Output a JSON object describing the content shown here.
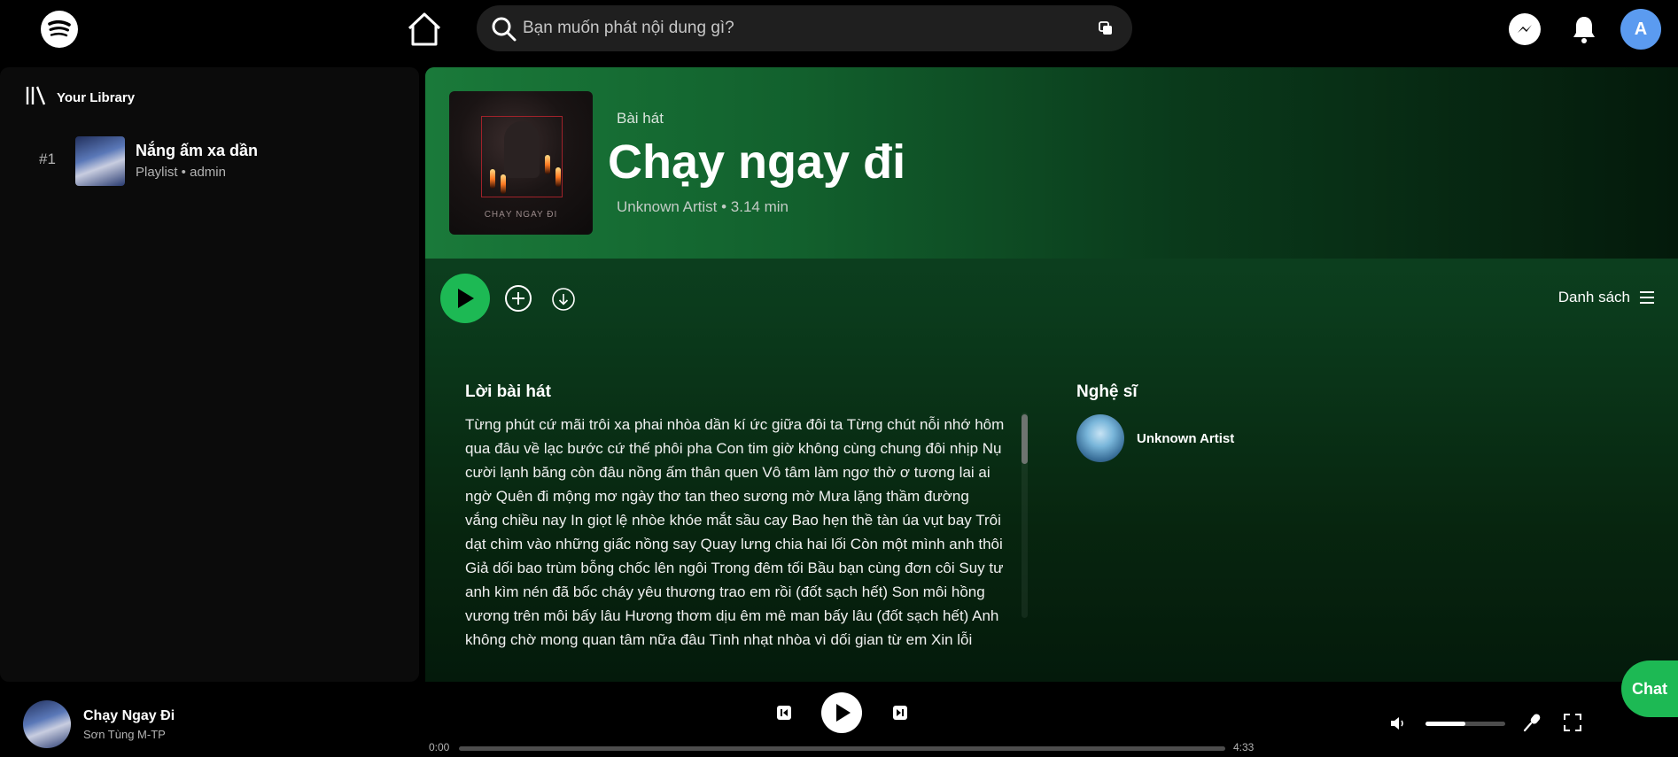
{
  "topbar": {
    "search_placeholder": "Bạn muốn phát nội dung gì?",
    "avatar_initial": "A"
  },
  "library": {
    "title": "Your Library",
    "items": [
      {
        "index": "#1",
        "title": "Nắng ấm xa dần",
        "subtitle": "Playlist • admin"
      }
    ]
  },
  "song": {
    "type_label": "Bài hát",
    "title": "Chạy ngay đi",
    "meta": "Unknown Artist • 3.14 min",
    "cover_text": "CHẠY NGAY ĐI"
  },
  "actions": {
    "list_view_label": "Danh sách"
  },
  "lyrics": {
    "heading": "Lời bài hát",
    "text": "Từng phút cứ mãi trôi xa phai nhòa dần kí ức giữa đôi ta Từng chút nỗi nhớ hôm qua đâu về lạc bước cứ thế phôi pha Con tim giờ không cùng chung đôi nhịp Nụ cười lạnh băng còn đâu nồng ấm thân quen Vô tâm làm ngơ thờ ơ tương lai ai ngờ Quên đi mộng mơ ngày thơ tan theo sương mờ Mưa lặng thầm đường vắng chiều nay In giọt lệ nhòe khóe mắt sầu cay Bao hẹn thề tàn úa vụt bay Trôi dạt chìm vào những giấc nồng say Quay lưng chia hai lối Còn một mình anh thôi Giả dối bao trùm bỗng chốc lên ngôi Trong đêm tối Bầu bạn cùng đơn côi Suy tư anh kìm nén đã bốc cháy yêu thương trao em rồi (đốt sạch hết) Son môi hồng vương trên môi bấy lâu Hương thơm dịu êm mê man bấy lâu (đốt sạch hết) Anh không chờ mong quan tâm nữa đâu Tình nhạt nhòa vì dối gian từ em Xin lỗi"
  },
  "artists": {
    "heading": "Nghệ sĩ",
    "items": [
      {
        "name": "Unknown Artist"
      }
    ]
  },
  "player": {
    "now_playing_title": "Chạy Ngay Đi",
    "now_playing_artist": "Sơn Tùng M-TP",
    "current_time": "0:00",
    "total_time": "4:33",
    "progress": 0.0,
    "volume": 0.5
  },
  "chat": {
    "label": "Chat"
  },
  "colors": {
    "accent": "#1db954",
    "avatar": "#5b9bf0",
    "background": "#000000"
  },
  "icons": [
    "spotify-logo-icon",
    "home-icon",
    "search-icon",
    "browse-icon",
    "messenger-icon",
    "bell-icon",
    "library-icon",
    "play-icon",
    "add-circle-icon",
    "download-icon",
    "list-icon",
    "previous-icon",
    "next-icon",
    "volume-icon",
    "mic-icon",
    "fullscreen-icon"
  ]
}
